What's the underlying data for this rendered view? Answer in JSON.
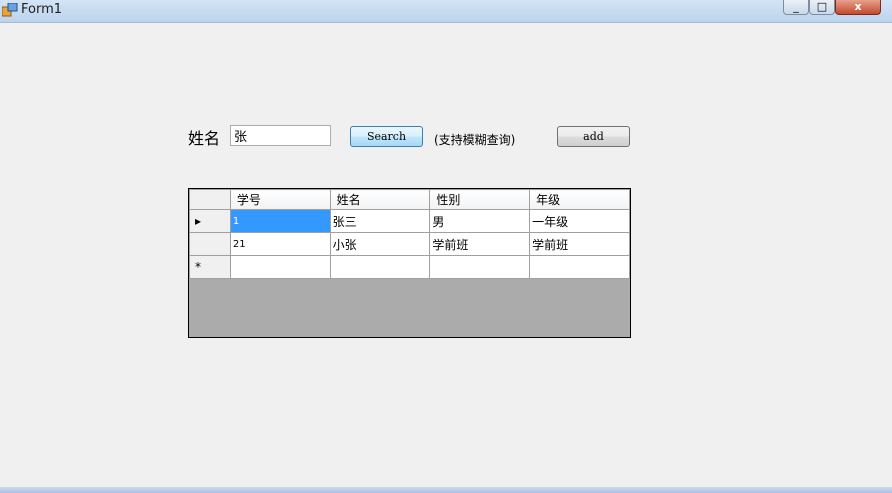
{
  "window": {
    "title": "Form1",
    "close_glyph": "x",
    "minimize_glyph": "_",
    "maximize_glyph": "□"
  },
  "form": {
    "name_label": "姓名",
    "name_value": "张",
    "search_label": "Search",
    "hint": "(支持模糊查询)",
    "add_label": "add"
  },
  "grid": {
    "columns": [
      "学号",
      "姓名",
      "性别",
      "年级"
    ],
    "rows": [
      {
        "id": "1",
        "name": "张三",
        "gender": "男",
        "grade": "一年级",
        "current": true
      },
      {
        "id": "21",
        "name": "小张",
        "gender": "学前班",
        "grade": "学前班",
        "current": false
      }
    ],
    "current_row_marker": "▸",
    "new_row_marker": "*"
  },
  "colors": {
    "selection": "#3399ff",
    "grid_background": "#ababab"
  }
}
